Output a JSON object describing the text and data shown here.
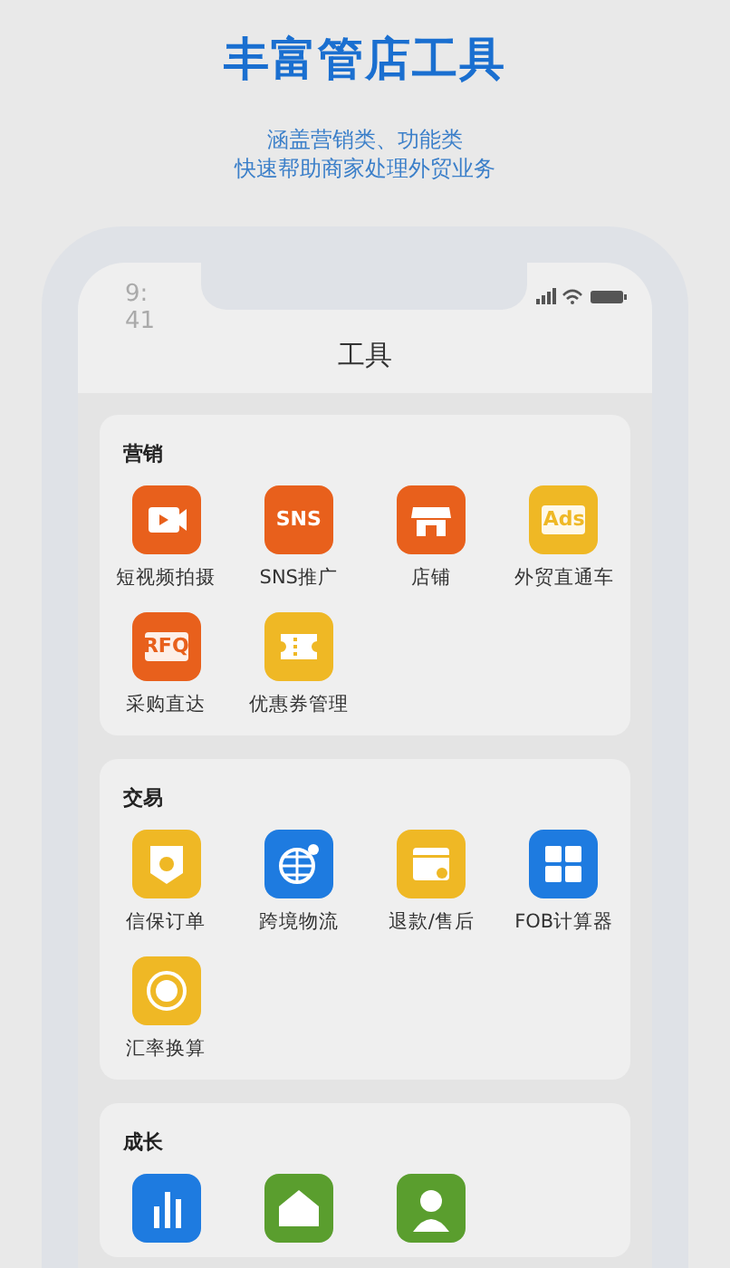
{
  "headline": "丰富管店工具",
  "subtitle": [
    "涵盖营销类、功能类",
    "快速帮助商家处理外贸业务"
  ],
  "phone": {
    "time": "9:41",
    "title": "工具"
  },
  "sections": [
    {
      "title": "营销",
      "tools": [
        {
          "label": "短视频拍摄",
          "kind": "video",
          "color": "#e8601c"
        },
        {
          "label": "SNS推广",
          "kind": "text",
          "glyph": "SNS",
          "color": "#e8601c"
        },
        {
          "label": "店铺",
          "kind": "store",
          "color": "#e8601c"
        },
        {
          "label": "外贸直通车",
          "kind": "tag",
          "glyph": "Ads",
          "color": "#efb825"
        },
        {
          "label": "采购直达",
          "kind": "tag",
          "glyph": "RFQ",
          "color": "#e8601c"
        },
        {
          "label": "优惠券管理",
          "kind": "ticket",
          "color": "#efb825"
        }
      ]
    },
    {
      "title": "交易",
      "tools": [
        {
          "label": "信保订单",
          "kind": "shield",
          "color": "#efb825"
        },
        {
          "label": "跨境物流",
          "kind": "globe",
          "color": "#1e7be0"
        },
        {
          "label": "退款/售后",
          "kind": "box",
          "color": "#efb825"
        },
        {
          "label": "FOB计算器",
          "kind": "calc",
          "color": "#1e7be0"
        },
        {
          "label": "汇率换算",
          "kind": "coin",
          "color": "#efb825"
        }
      ]
    },
    {
      "title": "成长",
      "tools": [
        {
          "kind": "chart",
          "color": "#1e7be0"
        },
        {
          "kind": "house",
          "color": "#5a9e2e"
        },
        {
          "kind": "person",
          "color": "#5a9e2e"
        }
      ]
    }
  ]
}
